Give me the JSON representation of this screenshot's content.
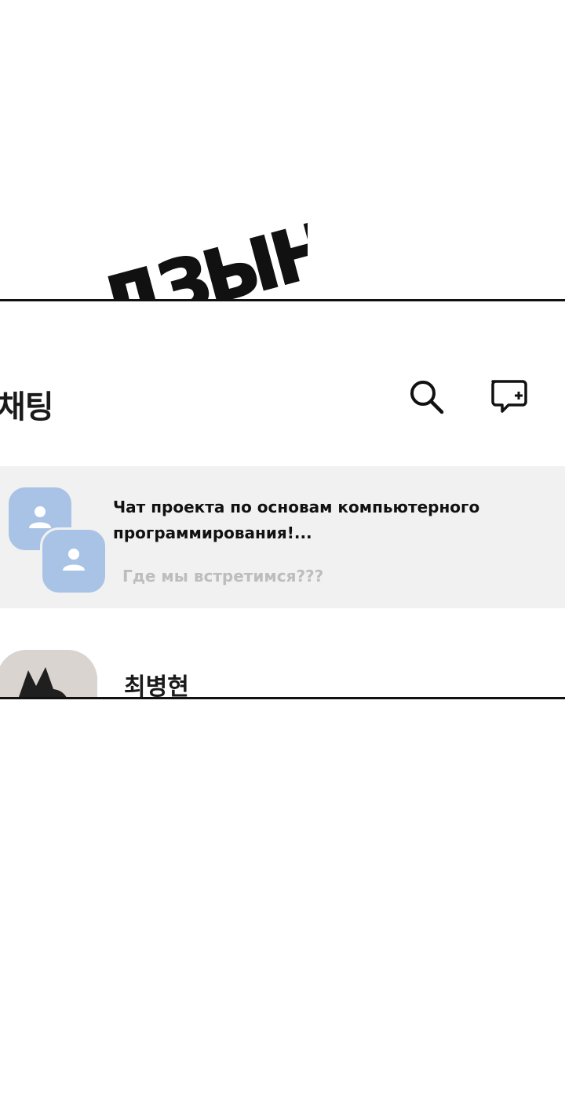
{
  "sfx": {
    "text": "ДЗЫНЬ"
  },
  "header": {
    "title": "채팅",
    "search_icon": "search-icon",
    "new_chat_icon": "new-chat-icon"
  },
  "chats": [
    {
      "title": "Чат проекта по основам компьютерного программирования!...",
      "preview": "Где мы встретимся???",
      "avatar": "group-avatar-icon"
    }
  ],
  "contacts": [
    {
      "name": "최병현",
      "avatar": "cartoon-avatar"
    }
  ],
  "colors": {
    "avatar_bg": "#a9c3e6",
    "row_highlight": "#f1f1f1",
    "preview_text": "#bdbdbd"
  }
}
